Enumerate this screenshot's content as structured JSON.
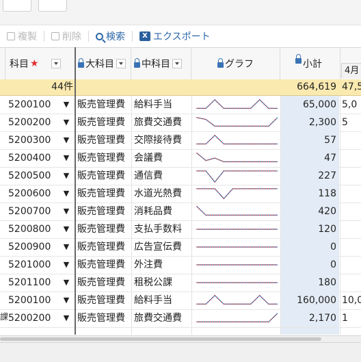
{
  "toolbar": {
    "copy_label": "複製",
    "delete_label": "削除",
    "search_label": "検索",
    "export_label": "エクスポート",
    "export_icon_text": "X"
  },
  "columns": {
    "account": "科目",
    "required_mark": "★",
    "major": "大科目",
    "minor": "中科目",
    "graph": "グラフ",
    "subtotal": "小計",
    "month": "4月"
  },
  "summary": {
    "count": "44件",
    "subtotal": "664,619",
    "month": "47,5"
  },
  "rows": [
    {
      "code": "5200100",
      "dd": "▼",
      "major": "販売管理費",
      "minor": "給料手当",
      "subtotal": "65,000",
      "month": "5,0",
      "spark": [
        0.2,
        0.2,
        0.9,
        0.2,
        0.2,
        0.2,
        0.2,
        0.9,
        0.2,
        0.2
      ]
    },
    {
      "code": "5200200",
      "dd": "▼",
      "major": "販売管理費",
      "minor": "旅費交通費",
      "subtotal": "2,300",
      "month": "5",
      "spark": [
        0.9,
        0.75,
        0.2,
        0.2,
        0.2,
        0.2,
        0.2,
        0.2,
        0.2,
        0.9
      ]
    },
    {
      "code": "5200300",
      "dd": "▼",
      "major": "販売管理費",
      "minor": "交際接待費",
      "subtotal": "57",
      "month": "",
      "spark": [
        0.2,
        0.2,
        0.9,
        0.2,
        0.2,
        0.2,
        0.2,
        0.2,
        0.2,
        0.2
      ]
    },
    {
      "code": "5200400",
      "dd": "▼",
      "major": "販売管理費",
      "minor": "会議費",
      "subtotal": "47",
      "month": "",
      "spark": [
        0.9,
        0.3,
        0.5,
        0.2,
        0.2,
        0.2,
        0.2,
        0.2,
        0.2,
        0.2
      ]
    },
    {
      "code": "5200500",
      "dd": "▼",
      "major": "販売管理費",
      "minor": "通信費",
      "subtotal": "227",
      "month": "",
      "spark": [
        0.9,
        0.9,
        0.0,
        0.9,
        0.9,
        0.9,
        0.9,
        0.9,
        0.9,
        0.9
      ]
    },
    {
      "code": "5200600",
      "dd": "▼",
      "major": "販売管理費",
      "minor": "水道光熱費",
      "subtotal": "118",
      "month": "",
      "spark": [
        0.9,
        0.9,
        0.9,
        0.1,
        0.9,
        0.9,
        0.9,
        0.9,
        0.9,
        0.9
      ]
    },
    {
      "code": "5200700",
      "dd": "▼",
      "major": "販売管理費",
      "minor": "消耗品費",
      "subtotal": "420",
      "month": "",
      "spark": [
        0.9,
        0.2,
        0.2,
        0.2,
        0.2,
        0.2,
        0.2,
        0.2,
        0.2,
        0.2
      ]
    },
    {
      "code": "5200800",
      "dd": "▼",
      "major": "販売管理費",
      "minor": "支払手数料",
      "subtotal": "120",
      "month": "",
      "spark": [
        0.5,
        0.5,
        0.5,
        0.5,
        0.5,
        0.5,
        0.5,
        0.5,
        0.5,
        0.5
      ]
    },
    {
      "code": "5200900",
      "dd": "▼",
      "major": "販売管理費",
      "minor": "広告宣伝費",
      "subtotal": "0",
      "month": "",
      "spark": [
        0.5,
        0.5,
        0.5,
        0.5,
        0.5,
        0.5,
        0.5,
        0.5,
        0.5,
        0.5
      ]
    },
    {
      "code": "5201000",
      "dd": "▼",
      "major": "販売管理費",
      "minor": "外注費",
      "subtotal": "0",
      "month": "",
      "spark": [
        0.5,
        0.5,
        0.5,
        0.5,
        0.5,
        0.5,
        0.5,
        0.5,
        0.5,
        0.5
      ]
    },
    {
      "code": "5201100",
      "dd": "▼",
      "major": "販売管理費",
      "minor": "租税公課",
      "subtotal": "180",
      "month": "",
      "spark": [
        0.5,
        0.5,
        0.5,
        0.5,
        0.5,
        0.5,
        0.5,
        0.5,
        0.5,
        0.5
      ]
    },
    {
      "code": "5200100",
      "dd": "▼",
      "major": "販売管理費",
      "minor": "給料手当",
      "subtotal": "160,000",
      "month": "10,0",
      "spark": [
        0.2,
        0.2,
        0.9,
        0.2,
        0.2,
        0.2,
        0.2,
        0.9,
        0.2,
        0.2
      ]
    },
    {
      "code": "5200200",
      "dd": "▼",
      "major": "販売管理費",
      "minor": "旅費交通費",
      "subtotal": "2,170",
      "month": "1",
      "spark": [
        0.2,
        0.2,
        0.2,
        0.2,
        0.2,
        0.2,
        0.2,
        0.2,
        0.2,
        0.9
      ]
    }
  ],
  "left_cut_text": "課",
  "colors": {
    "accent": "#2b66a8",
    "summary_bg": "#fbeab0",
    "subtotal_bg": "#e3ecf6",
    "spark_line": "#3a6fb0",
    "spark_dot": "#d9504a"
  }
}
